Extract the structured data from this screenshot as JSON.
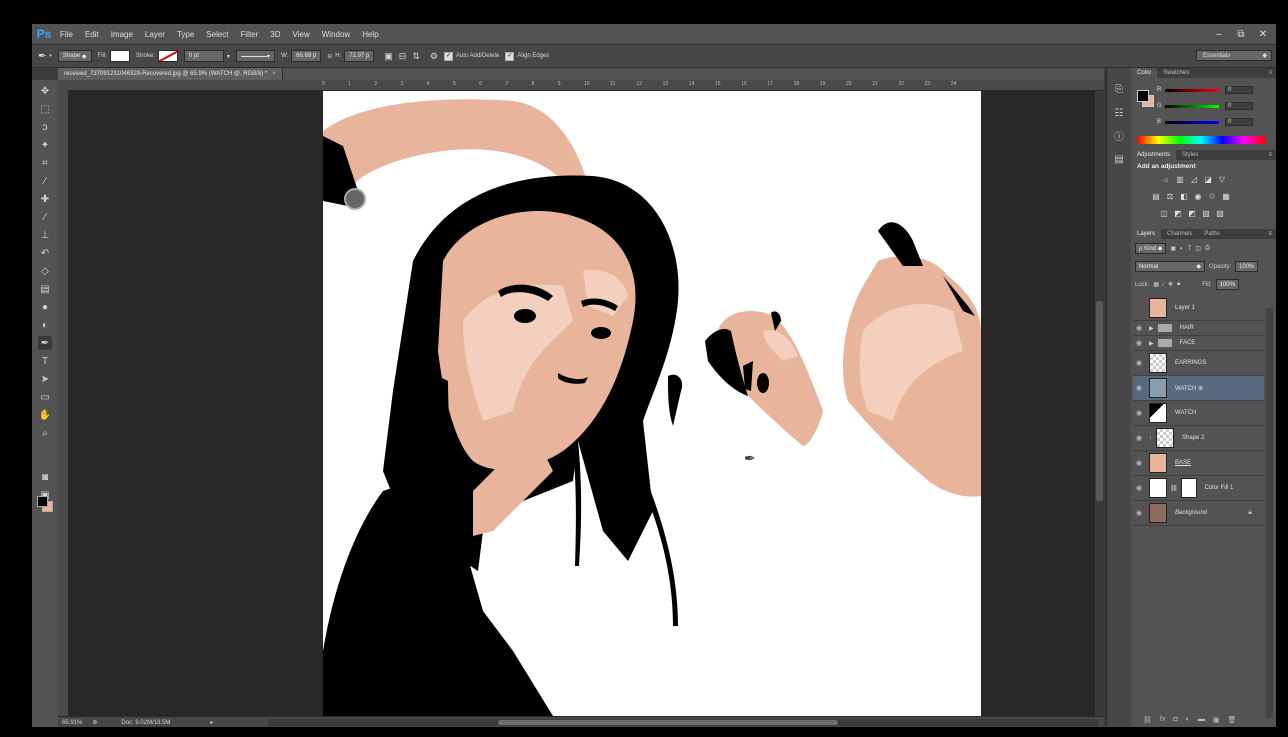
{
  "menu": [
    "File",
    "Edit",
    "Image",
    "Layer",
    "Type",
    "Select",
    "Filter",
    "3D",
    "View",
    "Window",
    "Help"
  ],
  "app_logo": "Ps",
  "window_controls": [
    "–",
    "⧉",
    "✕"
  ],
  "options": {
    "shape_mode": "Shape",
    "fill_label": "Fill:",
    "stroke_label": "Stroke:",
    "stroke_width": "0 pt",
    "w_label": "W:",
    "w_value": "66.69 p",
    "h_label": "H:",
    "h_value": "72.97 p",
    "auto_add_delete": "Auto Add/Delete",
    "align_edges": "Align Edges",
    "workspace": "Essentials"
  },
  "document_tab": "received_737091231046329-Recovered.jpg @ 65.9% (WATCH @, RGB/8) *",
  "ruler_numbers": [
    "0",
    "1",
    "2",
    "3",
    "4",
    "5",
    "6",
    "7",
    "8",
    "9",
    "10",
    "11",
    "12",
    "13",
    "14",
    "15",
    "16",
    "17",
    "18",
    "19",
    "20",
    "21",
    "22",
    "23",
    "24"
  ],
  "status": {
    "zoom": "65.91%",
    "doc": "Doc: 9.02M/18.5M"
  },
  "color_panel": {
    "tabs": [
      "Color",
      "Swatches"
    ],
    "r_label": "R",
    "g_label": "G",
    "b_label": "B",
    "r_value": "0",
    "g_value": "0",
    "b_value": "0",
    "fg_color": "#000000",
    "bg_color": "#e8b59c"
  },
  "adjustments_panel": {
    "tabs": [
      "Adjustments",
      "Styles"
    ],
    "title": "Add an adjustment"
  },
  "layers_panel": {
    "tabs": [
      "Layers",
      "Channels",
      "Paths"
    ],
    "kind_label": "ρ Kind",
    "blend_mode": "Normal",
    "opacity_label": "Opacity:",
    "opacity_value": "100%",
    "lock_label": "Lock:",
    "fill_label": "Fill:",
    "fill_value": "100%",
    "layers": [
      {
        "name": "Layer 1"
      },
      {
        "name": "HAIR"
      },
      {
        "name": "FACE"
      },
      {
        "name": "EARRINGS"
      },
      {
        "name": "WATCH ⊕"
      },
      {
        "name": "WATCH"
      },
      {
        "name": "Shape 2"
      },
      {
        "name": "BASE"
      },
      {
        "name": "Color Fill 1"
      },
      {
        "name": "Background"
      }
    ]
  },
  "colors": {
    "skin": "#e8b59c",
    "skin_light": "#f3d0bd",
    "hair": "#000000",
    "canvas_bg": "#ffffff",
    "selected_layer": "#596a80",
    "ps_blue": "#31a8ff"
  }
}
